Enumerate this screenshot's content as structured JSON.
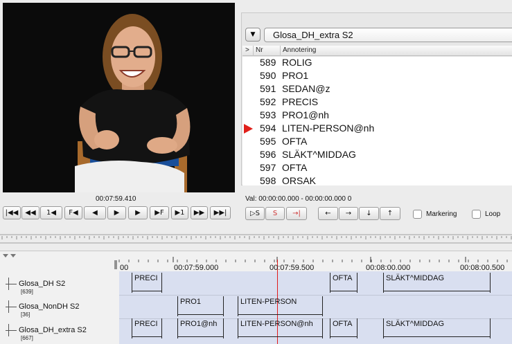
{
  "player": {
    "timecode": "00:07:59.410",
    "buttons": [
      {
        "name": "go-to-begin-button",
        "icon": "go-to-begin-icon",
        "label": "|◀◀"
      },
      {
        "name": "previous-scroll-view-button",
        "icon": "previous-scroll-view-icon",
        "label": "◀◀"
      },
      {
        "name": "step-back-button",
        "icon": "step-back-icon",
        "label": "1◀"
      },
      {
        "name": "frame-back-button",
        "icon": "frame-back-icon",
        "label": "F◀"
      },
      {
        "name": "selection-mode-back-button",
        "icon": "selection-back-icon",
        "label": "◀"
      },
      {
        "name": "play-button",
        "icon": "play-icon",
        "label": "▶"
      },
      {
        "name": "selection-mode-forward-button",
        "icon": "selection-forward-icon",
        "label": "▶"
      },
      {
        "name": "frame-forward-button",
        "icon": "frame-forward-icon",
        "label": "▶F"
      },
      {
        "name": "step-forward-button",
        "icon": "step-forward-icon",
        "label": "▶1"
      },
      {
        "name": "next-scroll-view-button",
        "icon": "next-scroll-view-icon",
        "label": "▶▶"
      },
      {
        "name": "go-to-end-button",
        "icon": "go-to-end-icon",
        "label": "▶▶|"
      }
    ]
  },
  "annotation_panel": {
    "tier_select": "Glosa_DH_extra S2",
    "columns": {
      "marker": ">",
      "nr": "Nr",
      "annotation": "Annotering"
    },
    "rows": [
      {
        "nr": "589",
        "text": "ROLIG",
        "current": false
      },
      {
        "nr": "590",
        "text": "PRO1",
        "current": false
      },
      {
        "nr": "591",
        "text": "SEDAN@z",
        "current": false
      },
      {
        "nr": "592",
        "text": "PRECIS",
        "current": false
      },
      {
        "nr": "593",
        "text": "PRO1@nh",
        "current": false
      },
      {
        "nr": "594",
        "text": "LITEN-PERSON@nh",
        "current": true
      },
      {
        "nr": "595",
        "text": "OFTA",
        "current": false
      },
      {
        "nr": "596",
        "text": "SLÄKT^MIDDAG",
        "current": false
      },
      {
        "nr": "597",
        "text": "OFTA",
        "current": false
      },
      {
        "nr": "598",
        "text": "ORSAK",
        "current": false
      }
    ]
  },
  "selection": {
    "text": "Val: 00:00:00.000 - 00:00:00.000  0",
    "buttons": [
      {
        "name": "play-selection-button",
        "label": "▷S"
      },
      {
        "name": "clear-selection-button",
        "label": "S"
      },
      {
        "name": "selection-to-crosshair-button",
        "label": "→|"
      },
      {
        "name": "active-annotation-left-button",
        "label": "←"
      },
      {
        "name": "active-annotation-right-button",
        "label": "→"
      },
      {
        "name": "active-annotation-down-button",
        "label": "↓"
      },
      {
        "name": "active-annotation-up-button",
        "label": "↑"
      }
    ],
    "markering_label": "Markering",
    "loop_label": "Loop"
  },
  "timeline": {
    "time_labels": [
      "00",
      "00:07:59.000",
      "00:07:59.500",
      "00:08:00.000",
      "00:08:00.500"
    ],
    "tiers": [
      {
        "name": "Glosa_DH S2",
        "count": "[639]"
      },
      {
        "name": "Glosa_NonDH S2",
        "count": "[36]"
      },
      {
        "name": "Glosa_DH_extra S2",
        "count": "[667]"
      }
    ],
    "annotations": {
      "dh": [
        "PRECI",
        "OFTA",
        "SLÄKT^MIDDAG"
      ],
      "nondh": [
        "PRO1",
        "LITEN-PERSON"
      ],
      "extra": [
        "PRECI",
        "PRO1@nh",
        "LITEN-PERSON@nh",
        "OFTA",
        "SLÄKT^MIDDAG"
      ]
    }
  },
  "colors": {
    "cursor": "#e01b1b",
    "current_marker": "#e0201a",
    "tier_background": "#d9dff0"
  }
}
